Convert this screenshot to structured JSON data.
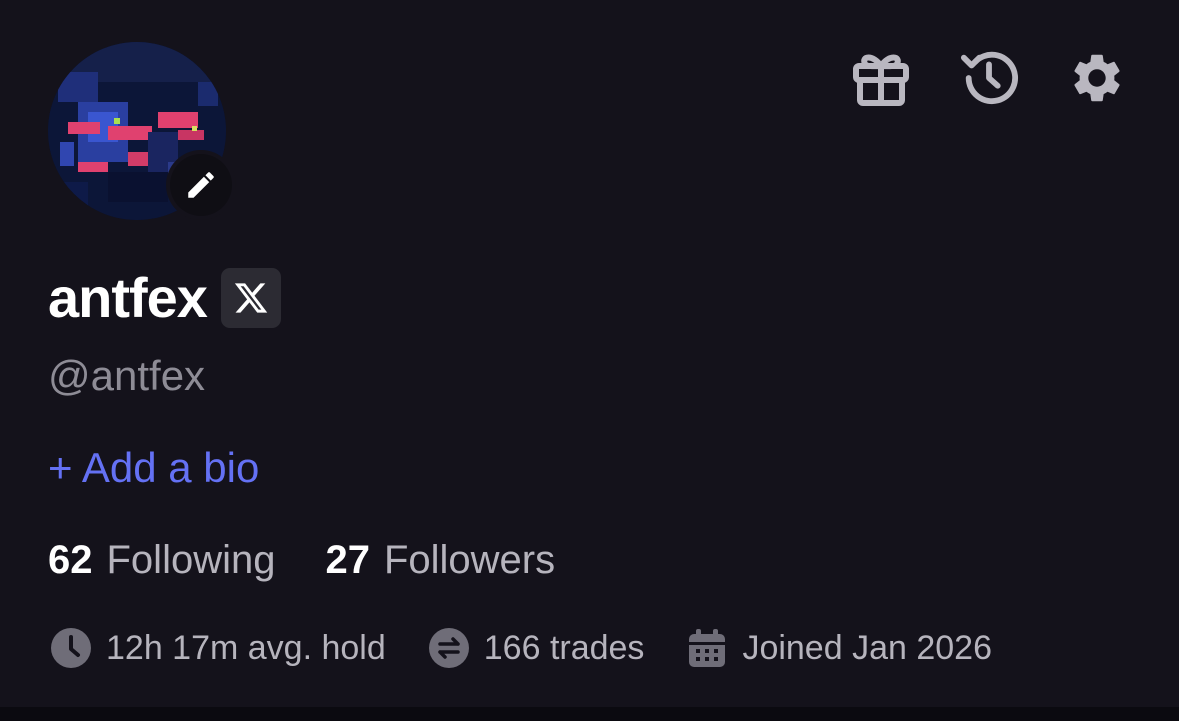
{
  "profile": {
    "display_name": "antfex",
    "handle": "@antfex",
    "add_bio": "+ Add a bio"
  },
  "social": {
    "following_count": "62",
    "following_label": "Following",
    "followers_count": "27",
    "followers_label": "Followers"
  },
  "stats": {
    "avg_hold": "12h 17m avg. hold",
    "trades": "166 trades",
    "joined": "Joined Jan 2026"
  },
  "icons": {
    "gift": "gift-icon",
    "history": "history-icon",
    "settings": "gear-icon",
    "edit": "pencil-icon",
    "x": "x-logo-icon",
    "clock": "clock-icon",
    "swap": "swap-icon",
    "calendar": "calendar-icon"
  },
  "colors": {
    "background": "#14121b",
    "accent": "#6471f4",
    "muted_text": "#8e8c96",
    "icon_gray": "#b9b7c0"
  }
}
